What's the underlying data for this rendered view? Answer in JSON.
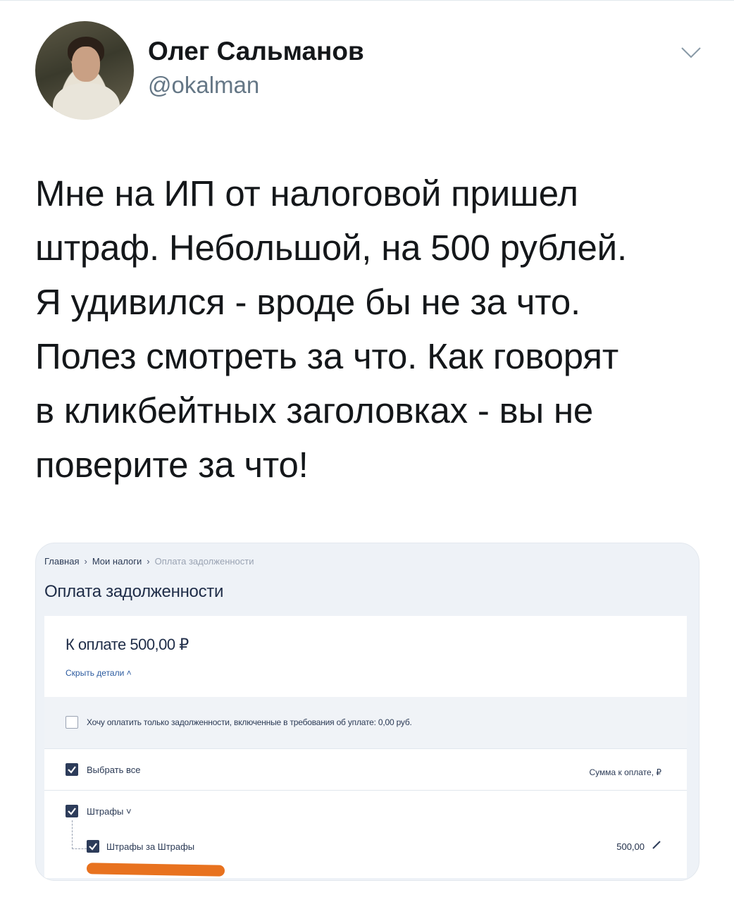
{
  "tweet": {
    "author_name": "Олег Сальманов",
    "author_handle": "@okalman",
    "text": "Мне на ИП от налоговой пришел\nштраф. Небольшой, на 500 рублей.\nЯ удивился - вроде бы не за что.\nПолез смотреть за что. Как говорят\nв кликбейтных заголовках - вы не\nповерите за что!"
  },
  "icons": {
    "menu": "chevron-down-icon",
    "avatar": "profile-photo"
  },
  "screenshot": {
    "breadcrumb": [
      "Главная",
      "Мои налоги",
      "Оплата задолженности"
    ],
    "breadcrumb_sep": "›",
    "title": "Оплата задолженности",
    "pay_total": "К оплате 500,00 ₽",
    "hide_details": "Скрыть детали ˄",
    "only_debt_label": "Хочу оплатить только задолженности, включенные в требования об уплате: 0,00 руб.",
    "only_debt_checked": false,
    "select_all_label": "Выбрать все",
    "select_all_checked": true,
    "amount_header": "Сумма к оплате, ₽",
    "category_label": "Штрафы ˅",
    "category_checked": true,
    "item_label": "Штрафы за Штрафы",
    "item_checked": true,
    "item_amount": "500,00"
  },
  "colors": {
    "highlight": "#e8721f",
    "checkbox": "#2d3c5a",
    "link": "#2b5a9f"
  }
}
